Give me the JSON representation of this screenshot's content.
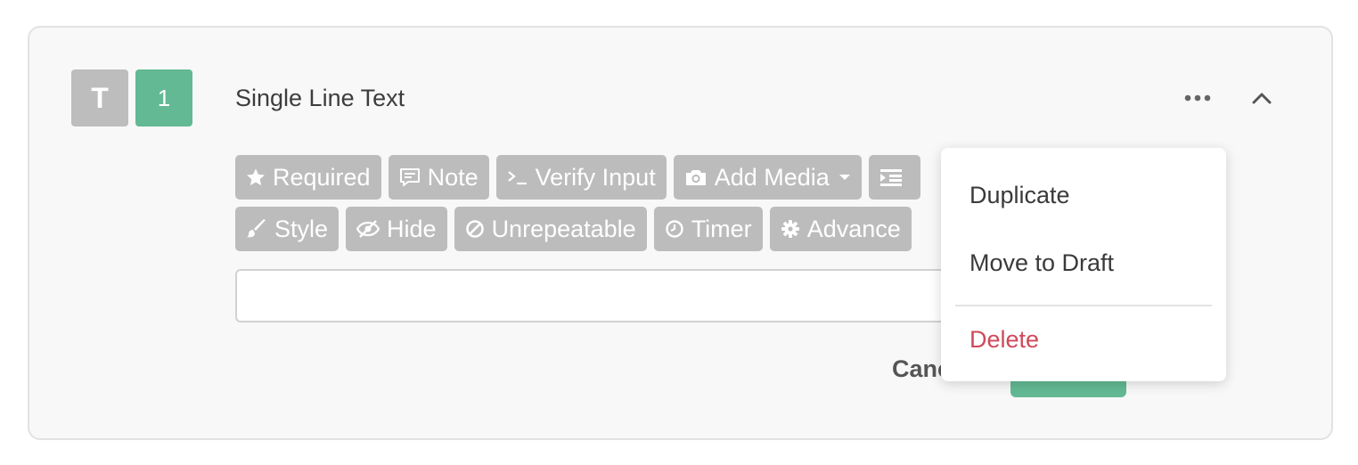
{
  "field": {
    "type_letter": "T",
    "number": "1",
    "title": "Single Line Text"
  },
  "toolbar": {
    "row1": [
      {
        "label": "Required",
        "icon": "star-icon"
      },
      {
        "label": "Note",
        "icon": "comment-icon"
      },
      {
        "label": "Verify Input",
        "icon": "terminal-icon"
      },
      {
        "label": "Add Media",
        "icon": "camera-icon"
      },
      {
        "label": "",
        "icon": "indent-icon"
      }
    ],
    "row2": [
      {
        "label": "Style",
        "icon": "brush-icon"
      },
      {
        "label": "Hide",
        "icon": "eye-slash-icon"
      },
      {
        "label": "Unrepeatable",
        "icon": "ban-icon"
      },
      {
        "label": "Timer",
        "icon": "clock-icon"
      },
      {
        "label": "Advance",
        "icon": "gear-icon"
      }
    ]
  },
  "input": {
    "value": "",
    "placeholder": ""
  },
  "actions": {
    "cancel_label": "Canc",
    "save_label": ""
  },
  "menu": {
    "items": [
      "Duplicate",
      "Move to Draft",
      "Delete"
    ]
  },
  "colors": {
    "accent_green": "#63b994",
    "chip_gray": "#bcbcbc",
    "badge_gray": "#bdbdbd",
    "danger_red": "#d0495b"
  }
}
